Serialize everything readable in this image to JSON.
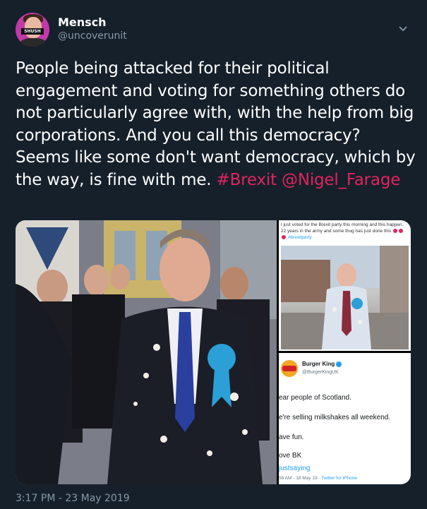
{
  "author": {
    "display_name": "Mensch",
    "handle": "@uncoverunit",
    "avatar_badge": "SHUSH"
  },
  "tweet": {
    "text_plain": "People being attacked for their political engagement and voting for something others do not particularly agree with, with the help from big corporations. And you call this democracy? Seems like some don't want democracy, which by the way, is fine with me.",
    "hashtag": "#Brexit",
    "mention": "@Nigel_Farage",
    "timestamp": "3:17 PM - 23 May 2019"
  },
  "media": {
    "right_top": {
      "caption": "I just voted for the Brexit party this morning and this happen. 22 years in the army and some thug has just done this",
      "hashtag": "#brexitparty"
    },
    "right_bottom": {
      "account_name": "Burger King",
      "account_handle": "@BurgerKingUK",
      "logo_text": "BURGER KING",
      "lines": [
        "ear people of Scotland.",
        "e're selling milkshakes all weekend.",
        "ave fun.",
        "ove BK"
      ],
      "hashtag": "justsaying",
      "meta": "58 AM · 18 May 19 ·",
      "meta_source": "Twitter for iPhone"
    }
  },
  "colors": {
    "background": "#15202b",
    "text": "#ffffff",
    "secondary": "#8899a6",
    "link": "#e0245e"
  },
  "icons": {
    "chevron": "chevron-down-icon",
    "verified": "verified-badge-icon"
  }
}
